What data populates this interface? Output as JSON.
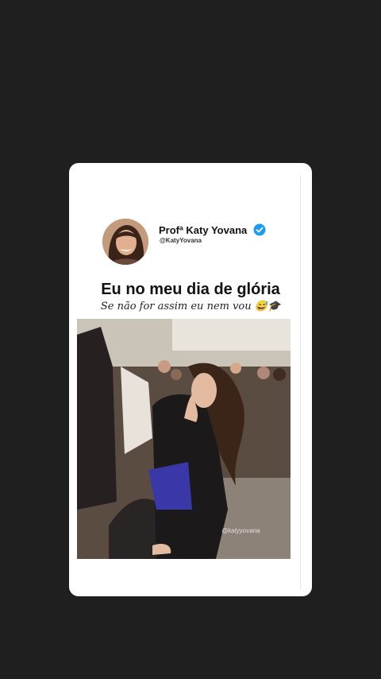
{
  "post": {
    "author_name": "Profª Katy Yovana",
    "handle": "@KatyYovana",
    "title": "Eu no meu dia de glória",
    "subtitle": "Se não for assim eu nem vou 😅🎓",
    "video_watermark": "@katyyovana"
  },
  "icons": {
    "verified": "verified-badge-icon",
    "avatar": "author-avatar"
  },
  "colors": {
    "background": "#1f1f1f",
    "card": "#ffffff",
    "verified": "#1d9bf0"
  }
}
